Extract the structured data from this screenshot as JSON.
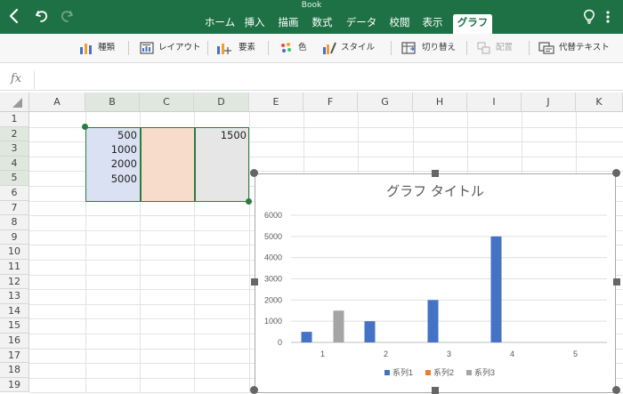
{
  "window": {
    "title": "Book"
  },
  "nav": {
    "back_icon": "chevron-left-icon",
    "undo_icon": "undo-icon",
    "redo_icon": "redo-icon"
  },
  "tabs": [
    {
      "label": "ホーム",
      "active": false
    },
    {
      "label": "挿入",
      "active": false
    },
    {
      "label": "描画",
      "active": false
    },
    {
      "label": "数式",
      "active": false
    },
    {
      "label": "データ",
      "active": false
    },
    {
      "label": "校閲",
      "active": false
    },
    {
      "label": "表示",
      "active": false
    },
    {
      "label": "グラフ",
      "active": true
    }
  ],
  "toolbar": {
    "type_label": "種類",
    "layout_label": "レイアウト",
    "elements_label": "要素",
    "color_label": "色",
    "style_label": "スタイル",
    "switch_label": "切り替え",
    "arrange_label": "配置",
    "alt_text_label": "代替テキスト"
  },
  "formula_bar": {
    "fx_label": "fx",
    "value": ""
  },
  "columns": [
    "A",
    "B",
    "C",
    "D",
    "E",
    "F",
    "G",
    "H",
    "I",
    "J",
    "K"
  ],
  "rows": [
    "1",
    "2",
    "3",
    "4",
    "5",
    "6",
    "7",
    "8",
    "9",
    "10",
    "11",
    "12",
    "13",
    "14",
    "15",
    "16",
    "17",
    "18",
    "19"
  ],
  "cells": {
    "B2": "500",
    "B3": "1000",
    "B4": "2000",
    "B5": "5000",
    "D2": "1500"
  },
  "colors": {
    "excel_green": "#1e7145",
    "series1": "#4472c4",
    "series2": "#ed7d31",
    "series3": "#a5a5a5",
    "range_blue": "#d9e1f2",
    "range_orange": "#f8dccb",
    "range_gray": "#e6e6e6"
  },
  "chart_data": {
    "type": "bar",
    "title": "グラフ タイトル",
    "categories": [
      "1",
      "2",
      "3",
      "4",
      "5"
    ],
    "series": [
      {
        "name": "系列1",
        "values": [
          500,
          1000,
          2000,
          5000,
          null
        ]
      },
      {
        "name": "系列2",
        "values": [
          null,
          null,
          null,
          null,
          null
        ]
      },
      {
        "name": "系列3",
        "values": [
          1500,
          null,
          null,
          null,
          null
        ]
      }
    ],
    "yticks": [
      "0",
      "1000",
      "2000",
      "3000",
      "4000",
      "5000",
      "6000"
    ],
    "ylim": [
      0,
      6000
    ],
    "grid": true,
    "legend_position": "bottom"
  }
}
